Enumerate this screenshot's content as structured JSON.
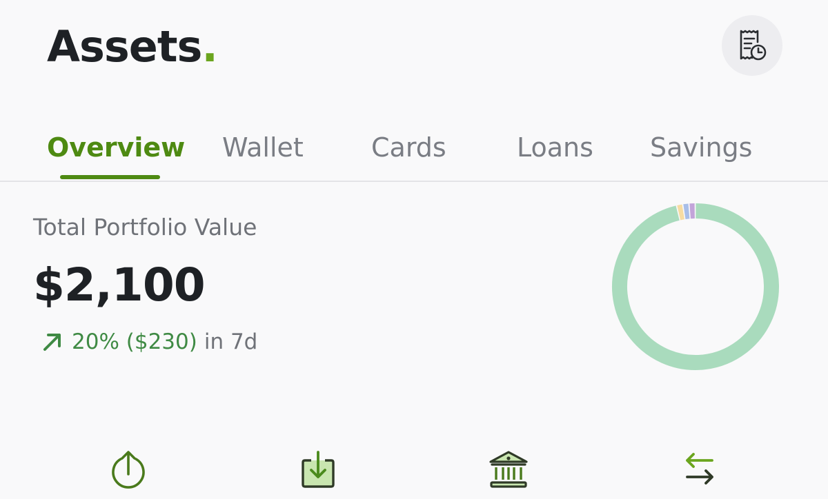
{
  "header": {
    "title": "Assets",
    "title_dot": ".",
    "history_icon": "receipt-clock-icon"
  },
  "tabs": [
    {
      "label": "Overview",
      "active": true
    },
    {
      "label": "Wallet",
      "active": false
    },
    {
      "label": "Cards",
      "active": false
    },
    {
      "label": "Loans",
      "active": false
    },
    {
      "label": "Savings",
      "active": false
    }
  ],
  "portfolio": {
    "label": "Total Portfolio Value",
    "value": "$2,100",
    "change": "20% ($230)",
    "period": "in 7d",
    "trend_icon": "arrow-up-right-icon"
  },
  "allocation_chart": {
    "type": "donut",
    "segments": [
      {
        "color": "#f7dca2",
        "fraction": 0.012
      },
      {
        "color": "#a8bee8",
        "fraction": 0.012
      },
      {
        "color": "#c2a4d9",
        "fraction": 0.012
      },
      {
        "color": "#a9dbbd",
        "fraction": 0.964
      }
    ]
  },
  "actions": [
    {
      "name": "send-icon"
    },
    {
      "name": "receive-icon"
    },
    {
      "name": "bank-icon"
    },
    {
      "name": "transfer-icon"
    }
  ],
  "colors": {
    "accent": "#4e8a12",
    "positive": "#3f8a44",
    "donut_main": "#a9dbbd"
  }
}
